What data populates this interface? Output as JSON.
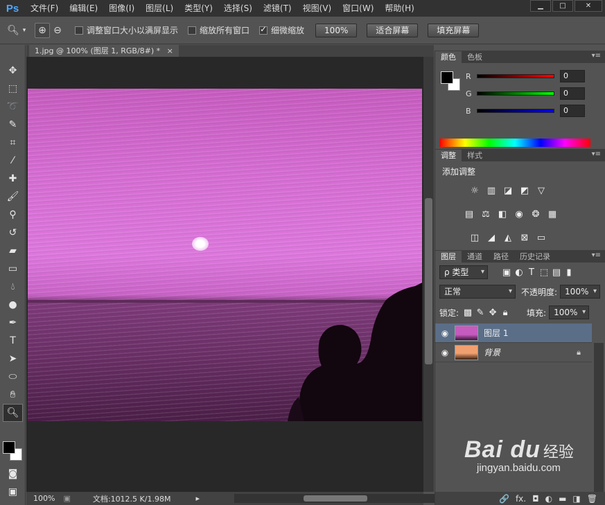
{
  "app": {
    "logo": "Ps"
  },
  "menu": [
    "文件(F)",
    "编辑(E)",
    "图像(I)",
    "图层(L)",
    "类型(Y)",
    "选择(S)",
    "滤镜(T)",
    "视图(V)",
    "窗口(W)",
    "帮助(H)"
  ],
  "window_controls": {
    "minimize": "▁",
    "maximize": "□",
    "close": "✕"
  },
  "options": {
    "resize_windows": "调整窗口大小以满屏显示",
    "zoom_all": "缩放所有窗口",
    "scrubby_zoom": "细微缩放",
    "zoom_100": "100%",
    "fit_screen": "适合屏幕",
    "fill_screen": "填充屏幕"
  },
  "document": {
    "tab_title": "1.jpg @ 100% (图层 1, RGB/8#) *",
    "close": "×"
  },
  "status": {
    "zoom": "100%",
    "doc_info": "文档:1012.5 K/1.98M"
  },
  "color_panel": {
    "tabs": [
      "颜色",
      "色板"
    ],
    "channels": [
      {
        "label": "R",
        "value": "0"
      },
      {
        "label": "G",
        "value": "0"
      },
      {
        "label": "B",
        "value": "0"
      }
    ]
  },
  "adjust_panel": {
    "tabs": [
      "调整",
      "样式"
    ],
    "title": "添加调整"
  },
  "layers_panel": {
    "tabs": [
      "图层",
      "通道",
      "路径",
      "历史记录"
    ],
    "filter": "ρ 类型",
    "blend_mode": "正常",
    "opacity_label": "不透明度:",
    "opacity": "100%",
    "lock_label": "锁定:",
    "fill_label": "填充:",
    "fill": "100%",
    "layers": [
      {
        "name": "图层 1"
      },
      {
        "name": "背景"
      }
    ],
    "footer_icons": [
      "🔗",
      "fx.",
      "◘",
      "◐",
      "▬",
      "◨",
      "🗑"
    ]
  },
  "watermark": {
    "logo": "Bai du",
    "sub": "经验",
    "url": "jingyan.baidu.com"
  }
}
